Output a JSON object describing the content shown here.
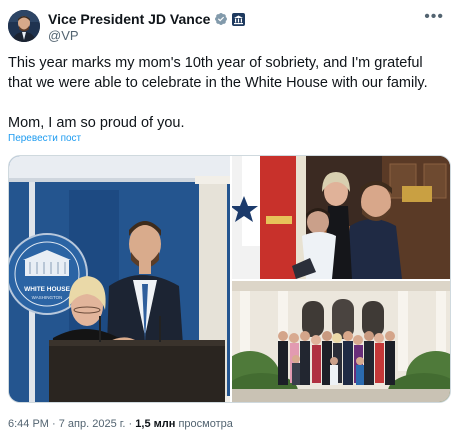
{
  "author": {
    "name": "Vice President JD Vance",
    "handle": "@VP",
    "verified_icon": "verified-badge-icon",
    "affiliation_icon": "government-badge-icon"
  },
  "post": {
    "paragraph1": "This year marks my mom's 10th year of sobriety, and I'm grateful that we were able to celebrate in the White House with our family.",
    "paragraph2": "Mom, I am so proud of you.",
    "translate_link": "Перевести пост"
  },
  "photos": {
    "seal_line1": "WHITE HOUSE",
    "seal_line2": "WASHINGTON"
  },
  "meta": {
    "time": "6:44 PM",
    "separator": " · ",
    "date": "7 апр. 2025 г.",
    "views_count": "1,5 млн",
    "views_label": "просмотра"
  },
  "colors": {
    "accent": "#1d9bf0",
    "verified": "#829aab",
    "text": "#0f1419",
    "muted": "#536471"
  }
}
